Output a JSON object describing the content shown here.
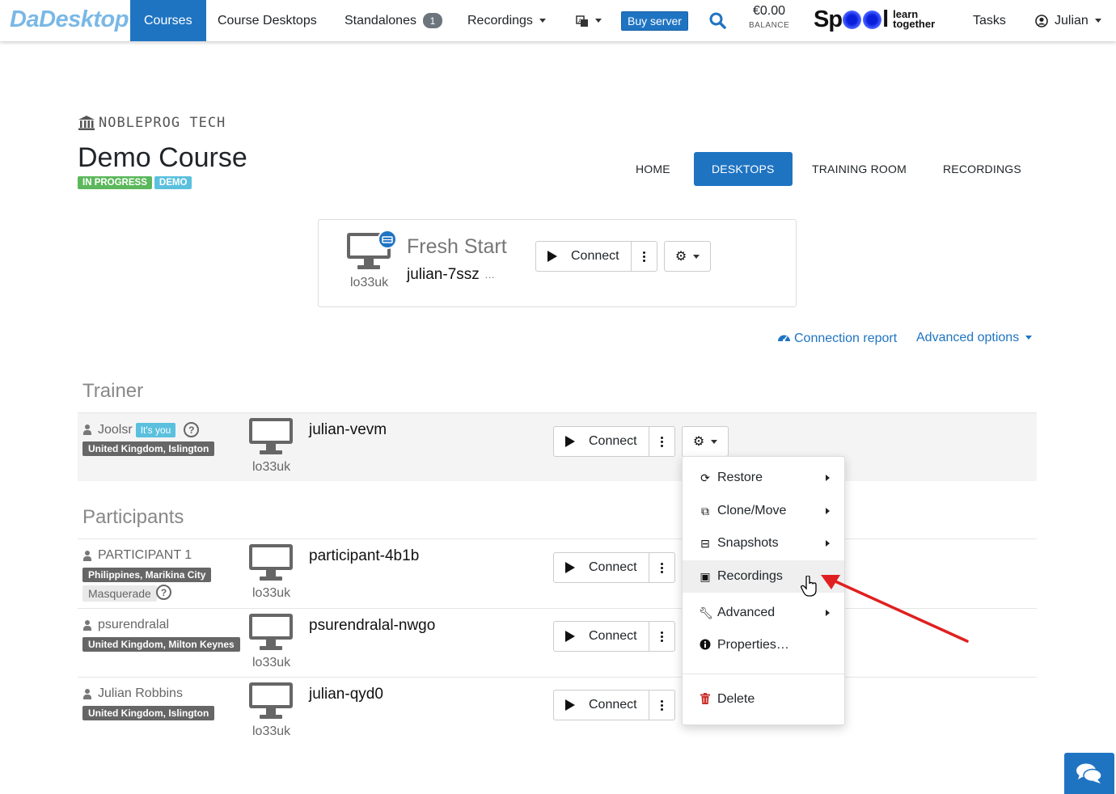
{
  "navbar": {
    "brand": "DaDesktop",
    "items": [
      {
        "label": "Courses",
        "active": true
      },
      {
        "label": "Course Desktops"
      },
      {
        "label": "Standalones",
        "badge": "1"
      },
      {
        "label": "Recordings"
      }
    ],
    "language_icon": "translate-icon",
    "buy_server": "Buy server",
    "search_icon": "search-icon",
    "balance_amount": "€0.00",
    "balance_label": "BALANCE",
    "spool_text_a": "Sp",
    "spool_text_b": "l",
    "spool_tag_1": "learn",
    "spool_tag_2": "together",
    "tasks": "Tasks",
    "user": "Julian"
  },
  "course": {
    "org": "NOBLEPROG TECH",
    "title": "Demo Course",
    "tags": [
      "IN PROGRESS",
      "DEMO"
    ],
    "tabs": [
      "HOME",
      "DESKTOPS",
      "TRAINING ROOM",
      "RECORDINGS"
    ],
    "active_tab": "DESKTOPS"
  },
  "fresh_start": {
    "title": "Fresh Start",
    "desktop": "julian-7ssz",
    "ellipsis": "…",
    "host": "lo33uk",
    "connect": "Connect"
  },
  "links": {
    "connection_report": "Connection report",
    "advanced_options": "Advanced options"
  },
  "sections": {
    "trainer": "Trainer",
    "participants": "Participants"
  },
  "trainer": {
    "name": "Joolsr",
    "its_you": "It's you",
    "location": "United Kingdom, Islington",
    "desktop": "julian-vevm",
    "host": "lo33uk",
    "connect": "Connect"
  },
  "participants": [
    {
      "name": "PARTICIPANT 1",
      "location": "Philippines, Marikina City",
      "masquerade": "Masquerade",
      "desktop": "participant-4b1b",
      "host": "lo33uk",
      "connect": "Connect"
    },
    {
      "name": "psurendralal",
      "location": "United Kingdom, Milton Keynes",
      "desktop": "psurendralal-nwgo",
      "host": "lo33uk",
      "connect": "Connect"
    },
    {
      "name": "Julian Robbins",
      "location": "United Kingdom, Islington",
      "desktop": "julian-qyd0",
      "host": "lo33uk",
      "connect": "Connect"
    }
  ],
  "menu": {
    "items": [
      {
        "label": "Restore",
        "icon": "sync-icon",
        "submenu": true
      },
      {
        "label": "Clone/Move",
        "icon": "copy-icon",
        "submenu": true
      },
      {
        "label": "Snapshots",
        "icon": "hdd-icon",
        "submenu": true
      },
      {
        "label": "Recordings",
        "icon": "file-video-icon",
        "submenu": false,
        "hovered": true
      },
      {
        "label": "Advanced",
        "icon": "wrench-icon",
        "submenu": true
      },
      {
        "label": "Properties…",
        "icon": "info-circle-icon",
        "submenu": false
      },
      {
        "label": "Delete",
        "icon": "trash-icon",
        "submenu": false
      }
    ]
  },
  "colors": {
    "primary": "#1f74c2",
    "success": "#5cb85c",
    "info": "#5bc0de",
    "annotation_arrow": "#e02020"
  }
}
